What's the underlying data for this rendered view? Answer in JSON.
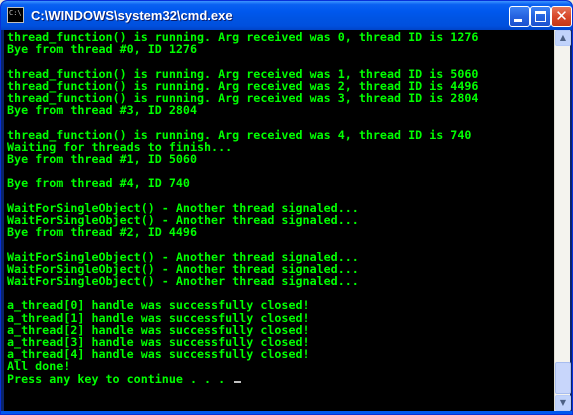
{
  "window": {
    "title": "C:\\WINDOWS\\system32\\cmd.exe",
    "icon_text": "C:\\"
  },
  "controls": {
    "minimize_icon": "minimize-icon",
    "maximize_icon": "maximize-icon",
    "close_icon": "close-icon",
    "close_glyph": "✕"
  },
  "scrollbar": {
    "up_arrow": "▲",
    "down_arrow": "▼"
  },
  "console": {
    "text_color": "#00ff00",
    "background": "#000000",
    "lines": [
      "thread_function() is running. Arg received was 0, thread ID is 1276",
      "Bye from thread #0, ID 1276",
      "",
      "thread_function() is running. Arg received was 1, thread ID is 5060",
      "thread_function() is running. Arg received was 2, thread ID is 4496",
      "thread_function() is running. Arg received was 3, thread ID is 2804",
      "Bye from thread #3, ID 2804",
      "",
      "thread_function() is running. Arg received was 4, thread ID is 740",
      "Waiting for threads to finish...",
      "Bye from thread #1, ID 5060",
      "",
      "Bye from thread #4, ID 740",
      "",
      "WaitForSingleObject() - Another thread signaled...",
      "WaitForSingleObject() - Another thread signaled...",
      "Bye from thread #2, ID 4496",
      "",
      "WaitForSingleObject() - Another thread signaled...",
      "WaitForSingleObject() - Another thread signaled...",
      "WaitForSingleObject() - Another thread signaled...",
      "",
      "a_thread[0] handle was successfully closed!",
      "a_thread[1] handle was successfully closed!",
      "a_thread[2] handle was successfully closed!",
      "a_thread[3] handle was successfully closed!",
      "a_thread[4] handle was successfully closed!",
      "All done!",
      "Press any key to continue . . . "
    ]
  }
}
